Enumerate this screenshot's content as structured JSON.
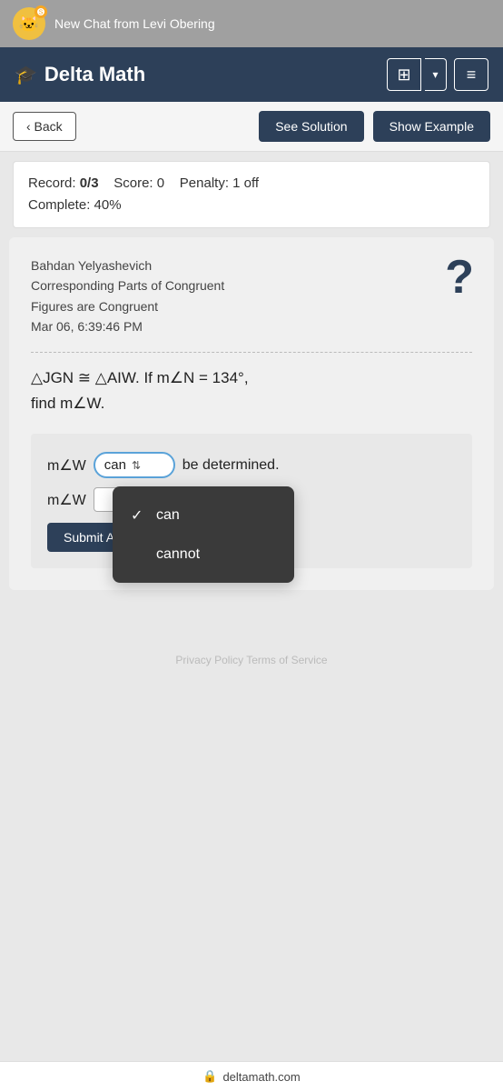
{
  "notification": {
    "text": "New Chat from Levi Obering",
    "emoji": "🐱"
  },
  "header": {
    "title": "Delta Math",
    "logo_symbol": "🎓",
    "calc_label": "⊞",
    "dropdown_arrow": "▾",
    "menu_label": "≡"
  },
  "toolbar": {
    "back_label": "‹ Back",
    "see_solution_label": "See Solution",
    "show_example_label": "Show Example"
  },
  "record": {
    "label": "Record:",
    "score_value": "0/3",
    "score_label": "Score: 0",
    "penalty_label": "Penalty: 1 off",
    "complete_label": "Complete: 40%"
  },
  "problem": {
    "student_name": "Bahdan Yelyashevich",
    "topic": "Corresponding Parts of Congruent",
    "topic2": "Figures are Congruent",
    "date": "Mar 06, 6:39:46 PM",
    "statement_part1": "△JGN ≅ △AIW. If m∠N = 134°,",
    "statement_part2": "find m∠W.",
    "help_symbol": "?"
  },
  "answer": {
    "prefix": "m∠W",
    "dropdown_value": "can",
    "suffix": "be determined.",
    "row2_prefix": "m∠W",
    "input_placeholder": "",
    "submit_label": "Submit A"
  },
  "dropdown_menu": {
    "items": [
      {
        "label": "can",
        "checked": true
      },
      {
        "label": "cannot",
        "checked": false
      }
    ]
  },
  "footer": {
    "links": "Privacy Policy   Terms of Service",
    "url": "deltamath.com",
    "lock_icon": "🔒"
  }
}
